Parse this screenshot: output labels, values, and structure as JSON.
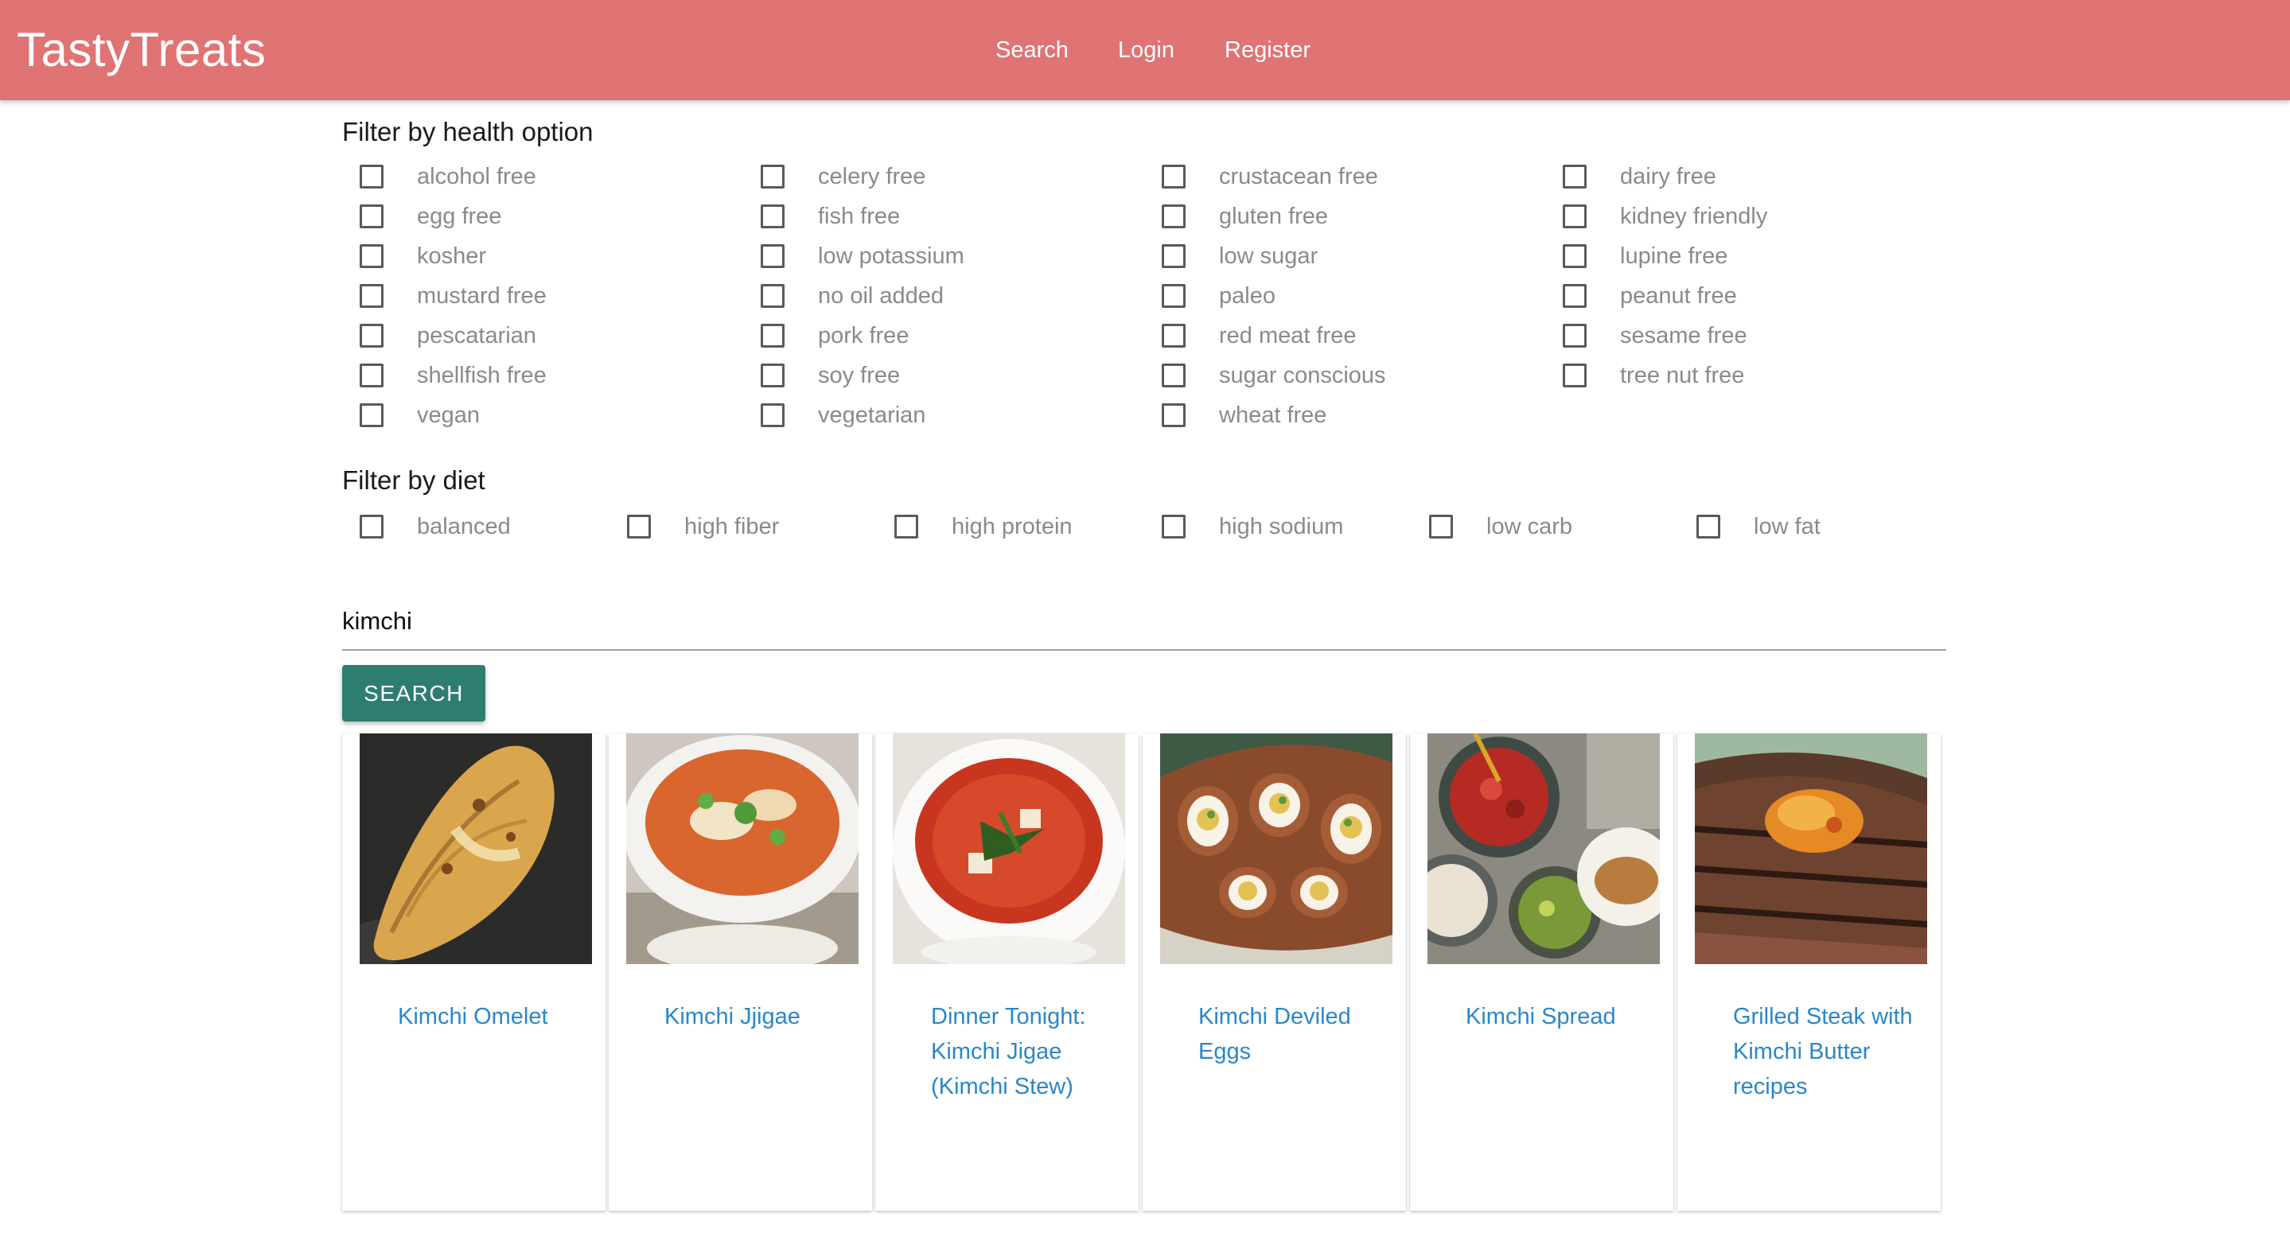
{
  "navbar": {
    "brand": "TastyTreats",
    "links": [
      "Search",
      "Login",
      "Register"
    ],
    "background": "#e07374"
  },
  "health_filter": {
    "title": "Filter by health option",
    "columns": [
      [
        "alcohol free",
        "egg free",
        "kosher",
        "mustard free",
        "pescatarian",
        "shellfish free",
        "vegan"
      ],
      [
        "celery free",
        "fish free",
        "low potassium",
        "no oil added",
        "pork free",
        "soy free",
        "vegetarian"
      ],
      [
        "crustacean free",
        "gluten free",
        "low sugar",
        "paleo",
        "red meat free",
        "sugar conscious",
        "wheat free"
      ],
      [
        "dairy free",
        "kidney friendly",
        "lupine free",
        "peanut free",
        "sesame free",
        "tree nut free"
      ]
    ],
    "checked": false
  },
  "diet_filter": {
    "title": "Filter by diet",
    "options": [
      "balanced",
      "high fiber",
      "high protein",
      "high sodium",
      "low carb",
      "low fat"
    ],
    "checked": false
  },
  "search": {
    "value": "kimchi",
    "button_label": "SEARCH",
    "button_color": "#2e7d73"
  },
  "results": [
    {
      "title": "Kimchi Omelet",
      "image": "omelet-photo"
    },
    {
      "title": "Kimchi Jjigae",
      "image": "jjigae-bowl-photo"
    },
    {
      "title": "Dinner Tonight: Kimchi Jigae (Kimchi Stew)",
      "image": "stew-bowl-photo"
    },
    {
      "title": "Kimchi Deviled Eggs",
      "image": "deviled-eggs-photo"
    },
    {
      "title": "Kimchi Spread",
      "image": "spread-bowls-photo"
    },
    {
      "title": "Grilled Steak with Kimchi Butter recipes",
      "image": "grilled-steak-photo"
    }
  ],
  "link_color": "#2b87c7"
}
